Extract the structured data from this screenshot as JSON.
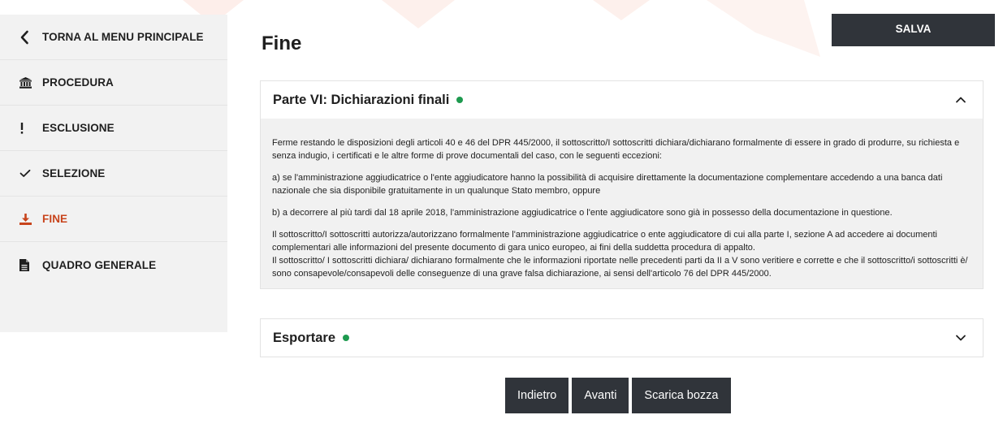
{
  "sidebar": {
    "items": [
      {
        "label": "TORNA AL MENU PRINCIPALE",
        "icon": "chevron-left-icon"
      },
      {
        "label": "PROCEDURA",
        "icon": "bank-icon"
      },
      {
        "label": "ESCLUSIONE",
        "icon": "exclamation-icon"
      },
      {
        "label": "SELEZIONE",
        "icon": "check-icon"
      },
      {
        "label": "FINE",
        "icon": "download-icon"
      },
      {
        "label": "QUADRO GENERALE",
        "icon": "document-icon"
      }
    ],
    "active_index": 4
  },
  "header": {
    "title": "Fine",
    "save_label": "SALVA"
  },
  "sections": [
    {
      "title": "Parte VI: Dichiarazioni finali",
      "expanded": true,
      "status": "complete",
      "paragraphs": [
        "Ferme restando le disposizioni degli articoli 40 e 46 del DPR 445/2000, il sottoscritto/I sottoscritti dichiara/dichiarano formalmente di essere in grado di produrre, su richiesta e senza indugio, i certificati e le altre forme di prove documentali del caso, con le seguenti eccezioni:",
        "a) se l'amministrazione aggiudicatrice o l'ente aggiudicatore hanno la possibilità di acquisire direttamente la documentazione complementare accedendo a una banca dati nazionale che sia disponibile gratuitamente in un qualunque Stato membro, oppure",
        "b) a decorrere al più tardi dal 18 aprile 2018, l'amministrazione aggiudicatrice o l'ente aggiudicatore sono già in possesso della documentazione in questione."
      ],
      "closing_lines": [
        "Il sottoscritto/I sottoscritti autorizza/autorizzano formalmente l'amministrazione aggiudicatrice o ente aggiudicatore di cui alla parte I, sezione A ad accedere ai documenti complementari alle informazioni del presente documento di gara unico europeo, ai fini della suddetta procedura di appalto.",
        "Il sottoscritto/ I sottoscritti dichiara/ dichiarano formalmente che le informazioni riportate nelle precedenti parti da II a V sono veritiere e corrette e che il sottoscritto/i sottoscritti è/ sono consapevole/consapevoli delle conseguenze di una grave falsa dichiarazione, ai sensi dell'articolo 76 del DPR 445/2000."
      ]
    },
    {
      "title": "Esportare",
      "expanded": false,
      "status": "complete"
    }
  ],
  "footer": {
    "back_label": "Indietro",
    "next_label": "Avanti",
    "download_label": "Scarica bozza"
  },
  "colors": {
    "accent": "#c8441c",
    "status_dot": "#1e9a4f",
    "button_bg": "#30343a",
    "sidebar_bg": "#f2f2f2"
  }
}
